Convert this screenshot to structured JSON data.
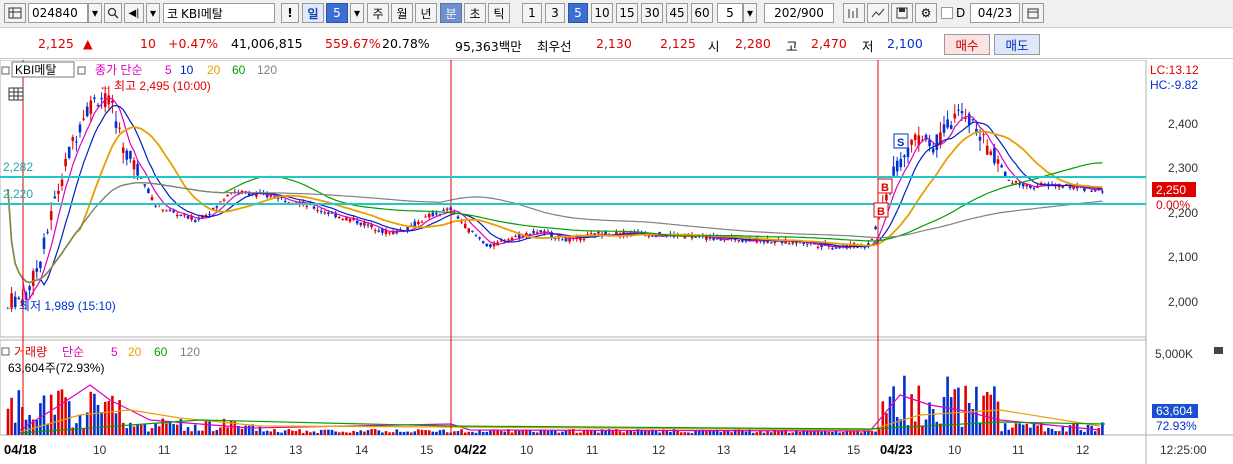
{
  "toolbar": {
    "stock_code": "024840",
    "market_prefix": "코",
    "stock_name": "KBI메탈",
    "exclaim": "!",
    "day_label": "일",
    "day_period": "5",
    "week_label": "주",
    "month_label": "월",
    "year_label": "년",
    "minute_label": "분",
    "second_label": "초",
    "tick_label": "틱",
    "intervals": [
      "1",
      "3",
      "5",
      "10",
      "15",
      "30",
      "45",
      "60"
    ],
    "selected_interval": "5",
    "count_value": "5",
    "page_counter": "202/900",
    "d_label": "D",
    "date_value": "04/23"
  },
  "quote": {
    "price": "2,125",
    "change_arrow": "▲",
    "change": "10",
    "change_pct": "+0.47%",
    "volume": "41,006,815",
    "volume_ratio": "559.67%",
    "turnover": "20.78%",
    "amount": "95,363백만",
    "best_label": "최우선",
    "best_ask": "2,130",
    "best_bid": "2,125",
    "open_label": "시",
    "open": "2,280",
    "high_label": "고",
    "high": "2,470",
    "low_label": "저",
    "low": "2,100",
    "buy_label": "매수",
    "sell_label": "매도"
  },
  "price_panel": {
    "legend": {
      "name": "KBI메탈",
      "ma_label": "종가 단순",
      "ma5": "5",
      "ma10": "10",
      "ma20": "20",
      "ma60": "60",
      "ma120": "120"
    },
    "high_note": "최고 2,495 (10:00)",
    "low_note": "최저 1,989 (15:10)",
    "hline1": "2,282",
    "hline2": "2,220",
    "lc": "LC:13.12",
    "hc": "HC:-9.82",
    "current_price": "2,250",
    "current_pct": "0.00%",
    "y_ticks": [
      "2,400",
      "2,300",
      "2,200",
      "2,100",
      "2,000"
    ],
    "marker_s": "S",
    "marker_b": "B"
  },
  "volume_panel": {
    "legend": {
      "name": "거래량",
      "ma_label": "단순",
      "ma5": "5",
      "ma20": "20",
      "ma60": "60",
      "ma120": "120"
    },
    "current_value": "63,604주(72.93%)",
    "y_tick": "5,000K",
    "last_value": "63,604",
    "last_pct": "72.93%"
  },
  "x_axis": {
    "labels": [
      "04/18",
      "10",
      "11",
      "12",
      "13",
      "14",
      "15",
      "04/22",
      "10",
      "11",
      "12",
      "13",
      "14",
      "15",
      "04/23",
      "10",
      "11",
      "12"
    ],
    "time": "12:25:00"
  },
  "colors": {
    "up": "#e00000",
    "down": "#0030d0",
    "ma5": "#e000c0",
    "ma10": "#0020c0",
    "ma20": "#e8a000",
    "ma60": "#00a000",
    "ma120": "#808080",
    "hline": "#20c8c8",
    "day_divider": "#e00000"
  }
}
